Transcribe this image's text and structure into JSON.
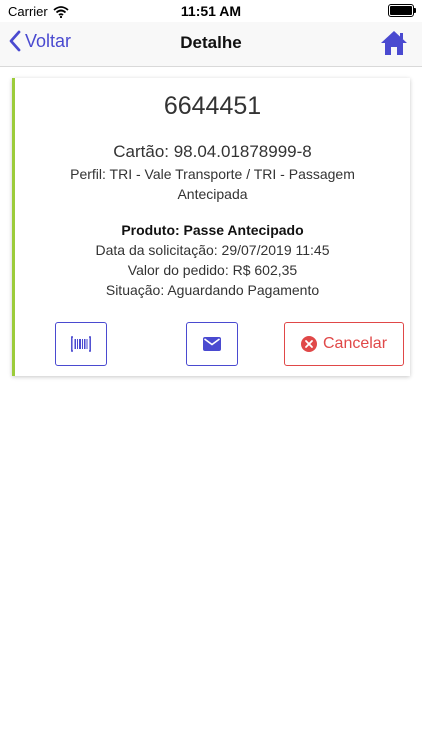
{
  "status_bar": {
    "carrier": "Carrier",
    "time": "11:51 AM"
  },
  "nav": {
    "back_label": "Voltar",
    "title": "Detalhe",
    "home_icon": "home-icon"
  },
  "card": {
    "number": "6644451",
    "cartao": "Cartão: 98.04.01878999-8",
    "perfil": "Perfil: TRI - Vale Transporte / TRI - Passagem Antecipada",
    "produto": "Produto: Passe Antecipado",
    "data_solicitacao": "Data da solicitação: 29/07/2019 11:45",
    "valor_pedido": "Valor do pedido: R$  602,35",
    "situacao": "Situação: Aguardando Pagamento",
    "accent_color": "#9ccc3a"
  },
  "actions": {
    "barcode_icon": "barcode-icon",
    "email_icon": "email-icon",
    "cancel_label": "Cancelar",
    "primary_color": "#4a4ad0",
    "danger_color": "#e04848"
  }
}
